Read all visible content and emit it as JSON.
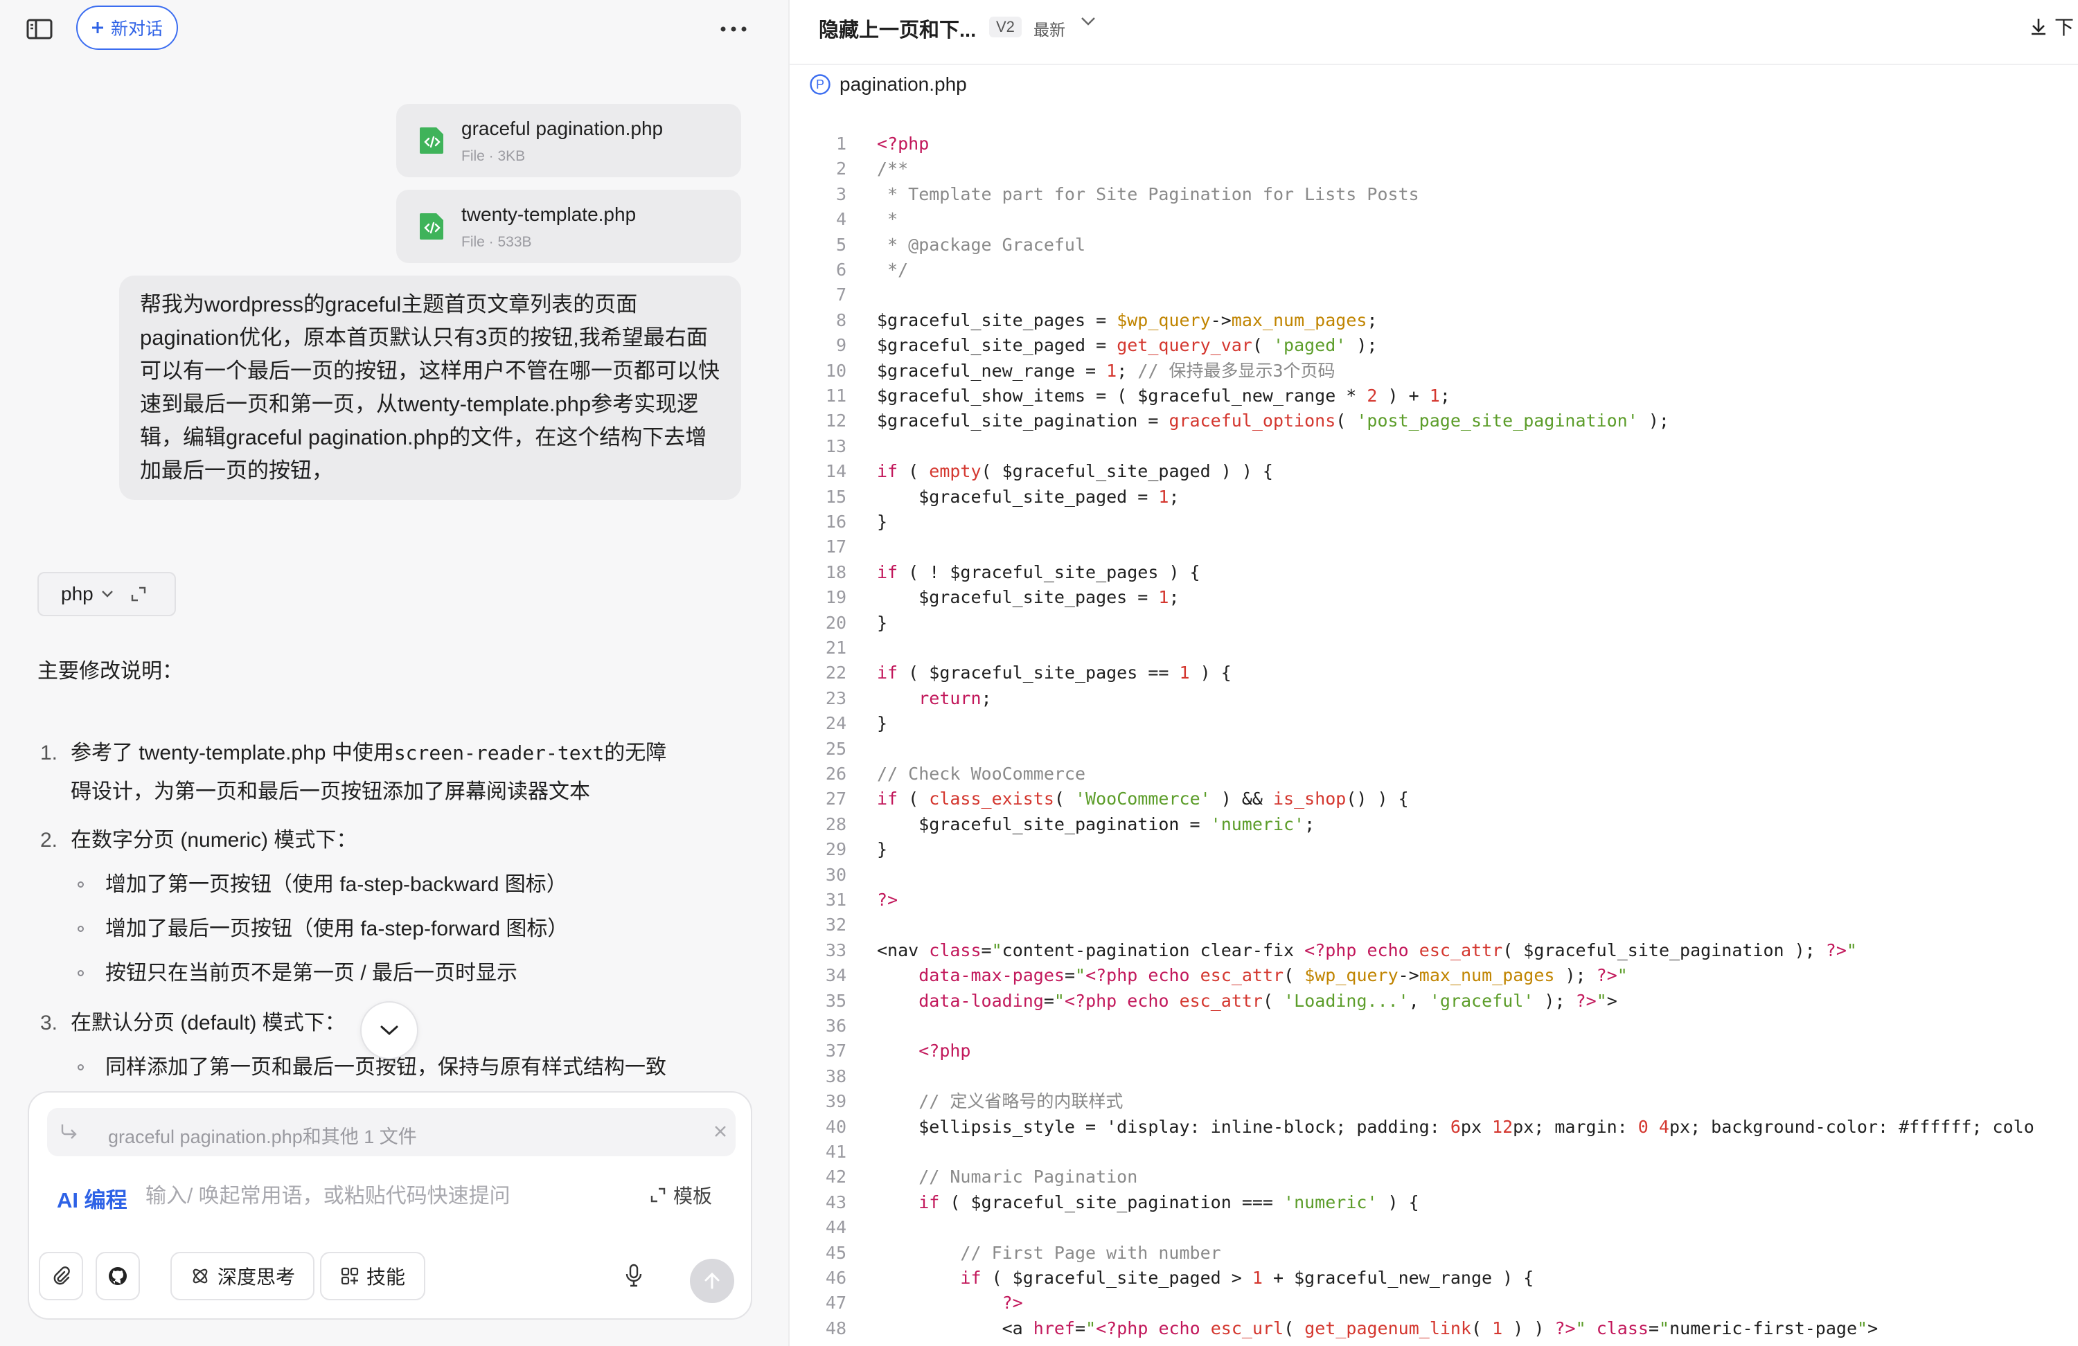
{
  "sidebar_panel": {
    "new_chat_label": "新对话"
  },
  "attachments": [
    {
      "name": "graceful pagination.php",
      "meta": "File · 3KB"
    },
    {
      "name": "twenty-template.php",
      "meta": "File · 533B"
    }
  ],
  "user_message": "帮我为wordpress的graceful主题首页文章列表的页面pagination优化，原本首页默认只有3页的按钮,我希望最右面可以有一个最后一页的按钮，这样用户不管在哪一页都可以快速到最后一页和第一页，从twenty-template.php参考实现逻辑，编辑graceful pagination.php的文件，在这个结构下去增加最后一页的按钮，",
  "reply": {
    "code_lang": "php",
    "summary_title": "主要修改说明：",
    "item1_num": "1.",
    "item1_pre": "参考了 twenty-template.php 中使用",
    "item1_code": "screen-reader-text",
    "item1_post": "的无障",
    "item1_line2": "碍设计，为第一页和最后一页按钮添加了屏幕阅读器文本",
    "item2_num": "2.",
    "item2": "在数字分页 (numeric) 模式下：",
    "item2_bullets": [
      "增加了第一页按钮（使用 fa-step-backward 图标）",
      "增加了最后一页按钮（使用 fa-step-forward 图标）",
      "按钮只在当前页不是第一页 / 最后一页时显示"
    ],
    "item3_num": "3.",
    "item3": "在默认分页 (default) 模式下：",
    "item3_bullets": [
      "同样添加了第一页和最后一页按钮，保持与原有样式结构一致"
    ]
  },
  "composer": {
    "attachment_chip": "graceful pagination.php和其他 1 文件",
    "mode_label": "AI 编程",
    "placeholder": "输入/ 唤起常用语，或粘贴代码快速提问",
    "template_label": "模板",
    "deep_think_label": "深度思考",
    "skills_label": "技能"
  },
  "doc": {
    "title": "隐藏上一页和下...",
    "version": "V2",
    "version_status": "最新",
    "download_label": "下",
    "file_name": "pagination.php",
    "file_icon_letter": "P"
  },
  "code_lines": [
    {
      "n": "1",
      "t": "<?php"
    },
    {
      "n": "2",
      "t": "/**"
    },
    {
      "n": "3",
      "t": " * Template part for Site Pagination for Lists Posts"
    },
    {
      "n": "4",
      "t": " *"
    },
    {
      "n": "5",
      "t": " * @package Graceful"
    },
    {
      "n": "6",
      "t": " */"
    },
    {
      "n": "7",
      "t": ""
    },
    {
      "n": "8",
      "t": "$graceful_site_pages = $wp_query->max_num_pages;"
    },
    {
      "n": "9",
      "t": "$graceful_site_paged = get_query_var( 'paged' );"
    },
    {
      "n": "10",
      "t": "$graceful_new_range = 1; // 保持最多显示3个页码"
    },
    {
      "n": "11",
      "t": "$graceful_show_items = ( $graceful_new_range * 2 ) + 1;"
    },
    {
      "n": "12",
      "t": "$graceful_site_pagination = graceful_options( 'post_page_site_pagination' );"
    },
    {
      "n": "13",
      "t": ""
    },
    {
      "n": "14",
      "t": "if ( empty( $graceful_site_paged ) ) {"
    },
    {
      "n": "15",
      "t": "    $graceful_site_paged = 1;"
    },
    {
      "n": "16",
      "t": "}"
    },
    {
      "n": "17",
      "t": ""
    },
    {
      "n": "18",
      "t": "if ( ! $graceful_site_pages ) {"
    },
    {
      "n": "19",
      "t": "    $graceful_site_pages = 1;"
    },
    {
      "n": "20",
      "t": "}"
    },
    {
      "n": "21",
      "t": ""
    },
    {
      "n": "22",
      "t": "if ( $graceful_site_pages == 1 ) {"
    },
    {
      "n": "23",
      "t": "    return;"
    },
    {
      "n": "24",
      "t": "}"
    },
    {
      "n": "25",
      "t": ""
    },
    {
      "n": "26",
      "t": "// Check WooCommerce"
    },
    {
      "n": "27",
      "t": "if ( class_exists( 'WooCommerce' ) && is_shop() ) {"
    },
    {
      "n": "28",
      "t": "    $graceful_site_pagination = 'numeric';"
    },
    {
      "n": "29",
      "t": "}"
    },
    {
      "n": "30",
      "t": ""
    },
    {
      "n": "31",
      "t": "?>"
    },
    {
      "n": "32",
      "t": ""
    },
    {
      "n": "33",
      "t": "<nav class=\"content-pagination clear-fix <?php echo esc_attr( $graceful_site_pagination ); ?>\""
    },
    {
      "n": "34",
      "t": "    data-max-pages=\"<?php echo esc_attr( $wp_query->max_num_pages ); ?>\""
    },
    {
      "n": "35",
      "t": "    data-loading=\"<?php echo esc_attr( 'Loading...', 'graceful' ); ?>\">"
    },
    {
      "n": "36",
      "t": ""
    },
    {
      "n": "37",
      "t": "    <?php"
    },
    {
      "n": "38",
      "t": ""
    },
    {
      "n": "39",
      "t": "    // 定义省略号的内联样式"
    },
    {
      "n": "40",
      "t": "    $ellipsis_style = 'display: inline-block; padding: 6px 12px; margin: 0 4px; background-color: #ffffff; colo"
    },
    {
      "n": "41",
      "t": ""
    },
    {
      "n": "42",
      "t": "    // Numaric Pagination"
    },
    {
      "n": "43",
      "t": "    if ( $graceful_site_pagination === 'numeric' ) {"
    },
    {
      "n": "44",
      "t": ""
    },
    {
      "n": "45",
      "t": "        // First Page with number"
    },
    {
      "n": "46",
      "t": "        if ( $graceful_site_paged > 1 + $graceful_new_range ) {"
    },
    {
      "n": "47",
      "t": "            ?>"
    },
    {
      "n": "48",
      "t": "            <a href=\"<?php echo esc_url( get_pagenum_link( 1 ) ) ?>\" class=\"numeric-first-page\">"
    }
  ]
}
